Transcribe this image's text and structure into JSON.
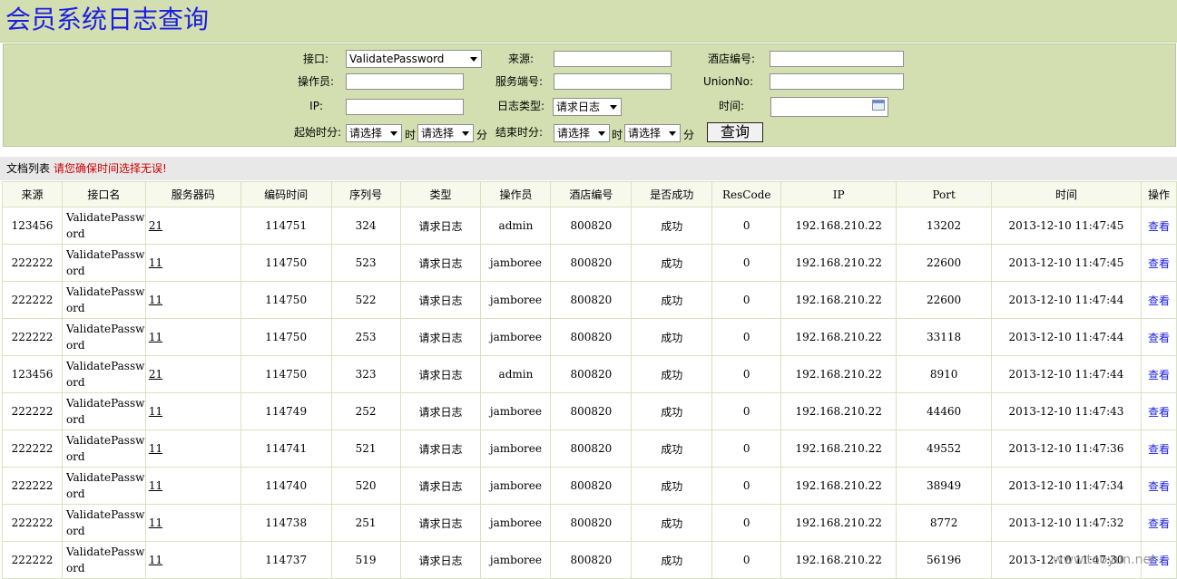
{
  "title": "会员系统日志查询",
  "filters": {
    "interface_label": "接口:",
    "interface_value": "ValidatePassword",
    "source_label": "来源:",
    "hotel_no_label": "酒店编号:",
    "operator_label": "操作员:",
    "service_port_label": "服务端号:",
    "unionno_label": "UnionNo:",
    "ip_label": "IP:",
    "log_type_label": "日志类型:",
    "log_type_value": "请求日志",
    "time_label": "时间:",
    "start_label": "起始时分:",
    "end_label": "结束时分:",
    "select_placeholder": "请选择",
    "hour_unit": "时",
    "minute_unit": "分",
    "query_button": "查询"
  },
  "list": {
    "title": "文档列表",
    "warning": "请您确保时间选择无误!"
  },
  "table": {
    "headers": [
      "来源",
      "接口名",
      "服务器码",
      "编码时间",
      "序列号",
      "类型",
      "操作员",
      "酒店编号",
      "是否成功",
      "ResCode",
      "IP",
      "Port",
      "时间",
      "操作"
    ],
    "rows": [
      {
        "source": "123456",
        "api": "ValidatePassword",
        "server": "21",
        "code_time": "114751",
        "seq": "324",
        "type": "请求日志",
        "operator": "admin",
        "hotel": "800820",
        "success": "成功",
        "rescode": "0",
        "ip": "192.168.210.22",
        "port": "13202",
        "time": "2013-12-10 11:47:45",
        "action": "查看"
      },
      {
        "source": "222222",
        "api": "ValidatePassword",
        "server": "11",
        "code_time": "114750",
        "seq": "523",
        "type": "请求日志",
        "operator": "jamboree",
        "hotel": "800820",
        "success": "成功",
        "rescode": "0",
        "ip": "192.168.210.22",
        "port": "22600",
        "time": "2013-12-10 11:47:45",
        "action": "查看"
      },
      {
        "source": "222222",
        "api": "ValidatePassword",
        "server": "11",
        "code_time": "114750",
        "seq": "522",
        "type": "请求日志",
        "operator": "jamboree",
        "hotel": "800820",
        "success": "成功",
        "rescode": "0",
        "ip": "192.168.210.22",
        "port": "22600",
        "time": "2013-12-10 11:47:44",
        "action": "查看"
      },
      {
        "source": "222222",
        "api": "ValidatePassword",
        "server": "11",
        "code_time": "114750",
        "seq": "253",
        "type": "请求日志",
        "operator": "jamboree",
        "hotel": "800820",
        "success": "成功",
        "rescode": "0",
        "ip": "192.168.210.22",
        "port": "33118",
        "time": "2013-12-10 11:47:44",
        "action": "查看"
      },
      {
        "source": "123456",
        "api": "ValidatePassword",
        "server": "21",
        "code_time": "114750",
        "seq": "323",
        "type": "请求日志",
        "operator": "admin",
        "hotel": "800820",
        "success": "成功",
        "rescode": "0",
        "ip": "192.168.210.22",
        "port": "8910",
        "time": "2013-12-10 11:47:44",
        "action": "查看"
      },
      {
        "source": "222222",
        "api": "ValidatePassword",
        "server": "11",
        "code_time": "114749",
        "seq": "252",
        "type": "请求日志",
        "operator": "jamboree",
        "hotel": "800820",
        "success": "成功",
        "rescode": "0",
        "ip": "192.168.210.22",
        "port": "44460",
        "time": "2013-12-10 11:47:43",
        "action": "查看"
      },
      {
        "source": "222222",
        "api": "ValidatePassword",
        "server": "11",
        "code_time": "114741",
        "seq": "521",
        "type": "请求日志",
        "operator": "jamboree",
        "hotel": "800820",
        "success": "成功",
        "rescode": "0",
        "ip": "192.168.210.22",
        "port": "49552",
        "time": "2013-12-10 11:47:36",
        "action": "查看"
      },
      {
        "source": "222222",
        "api": "ValidatePassword",
        "server": "11",
        "code_time": "114740",
        "seq": "520",
        "type": "请求日志",
        "operator": "jamboree",
        "hotel": "800820",
        "success": "成功",
        "rescode": "0",
        "ip": "192.168.210.22",
        "port": "38949",
        "time": "2013-12-10 11:47:34",
        "action": "查看"
      },
      {
        "source": "222222",
        "api": "ValidatePassword",
        "server": "11",
        "code_time": "114738",
        "seq": "251",
        "type": "请求日志",
        "operator": "jamboree",
        "hotel": "800820",
        "success": "成功",
        "rescode": "0",
        "ip": "192.168.210.22",
        "port": "8772",
        "time": "2013-12-10 11:47:32",
        "action": "查看"
      },
      {
        "source": "222222",
        "api": "ValidatePassword",
        "server": "11",
        "code_time": "114737",
        "seq": "519",
        "type": "请求日志",
        "operator": "jamboree",
        "hotel": "800820",
        "success": "成功",
        "rescode": "0",
        "ip": "192.168.210.22",
        "port": "56196",
        "time": "2013-12-10 11:47:30",
        "action": "查看"
      }
    ]
  },
  "watermark": "www.tooyun.net"
}
